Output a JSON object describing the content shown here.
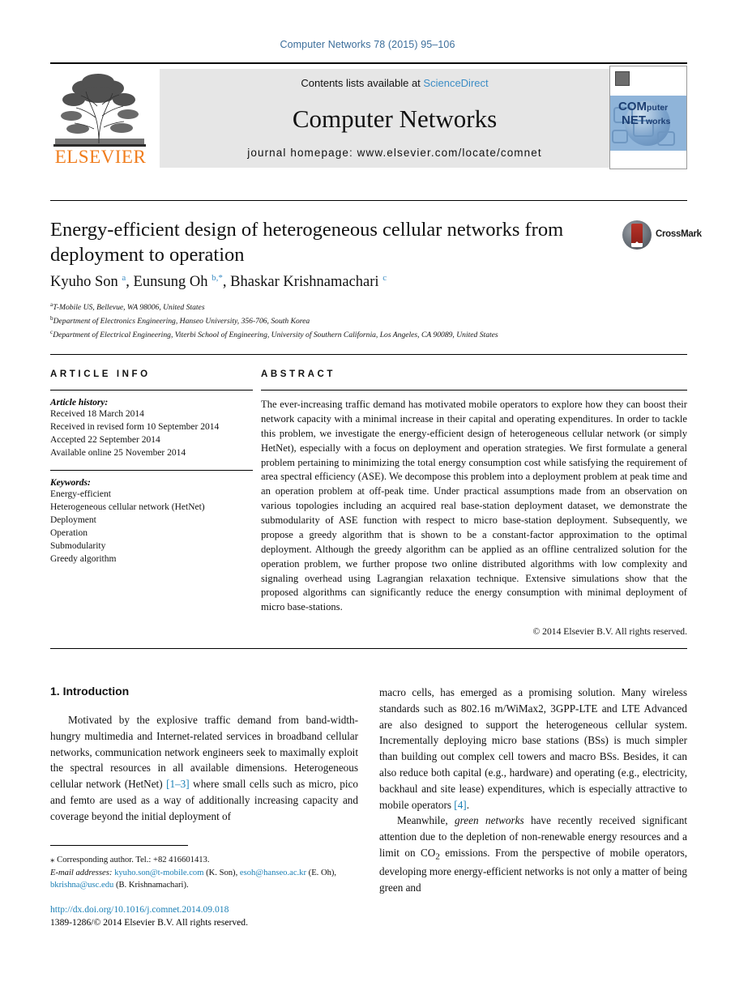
{
  "running_head": "Computer Networks 78 (2015) 95–106",
  "masthead": {
    "contents_prefix": "Contents lists available at",
    "contents_link": "ScienceDirect",
    "journal_title": "Computer Networks",
    "homepage": "journal homepage: www.elsevier.com/locate/comnet",
    "publisher_wordmark": "ELSEVIER",
    "cover_word_1": "COM",
    "cover_word_1_sub": "puter",
    "cover_word_2": "NET",
    "cover_word_2_sub": "works"
  },
  "article": {
    "title": "Energy-efficient design of heterogeneous cellular networks from deployment to operation",
    "crossmark_label": "CrossMark",
    "authors_html": "Kyuho Son <sup>a</sup>, Eunsung Oh <sup>b,*</sup>, Bhaskar Krishnamachari <sup>c</sup>",
    "affiliations": [
      "T-Mobile US, Bellevue, WA 98006, United States",
      "Department of Electronics Engineering, Hanseo University, 356-706, South Korea",
      "Department of Electrical Engineering, Viterbi School of Engineering, University of Southern California, Los Angeles, CA 90089, United States"
    ],
    "affiliation_marks": [
      "a",
      "b",
      "c"
    ]
  },
  "info": {
    "heading": "ARTICLE INFO",
    "history_title": "Article history:",
    "history": [
      "Received 18 March 2014",
      "Received in revised form 10 September 2014",
      "Accepted 22 September 2014",
      "Available online 25 November 2014"
    ],
    "keywords_title": "Keywords:",
    "keywords": [
      "Energy-efficient",
      "Heterogeneous cellular network (HetNet)",
      "Deployment",
      "Operation",
      "Submodularity",
      "Greedy algorithm"
    ]
  },
  "abstract": {
    "heading": "ABSTRACT",
    "text": "The ever-increasing traffic demand has motivated mobile operators to explore how they can boost their network capacity with a minimal increase in their capital and operating expenditures. In order to tackle this problem, we investigate the energy-efficient design of heterogeneous cellular network (or simply HetNet), especially with a focus on deployment and operation strategies. We first formulate a general problem pertaining to minimizing the total energy consumption cost while satisfying the requirement of area spectral efficiency (ASE). We decompose this problem into a deployment problem at peak time and an operation problem at off-peak time. Under practical assumptions made from an observation on various topologies including an acquired real base-station deployment dataset, we demonstrate the submodularity of ASE function with respect to micro base-station deployment. Subsequently, we propose a greedy algorithm that is shown to be a constant-factor approximation to the optimal deployment. Although the greedy algorithm can be applied as an offline centralized solution for the operation problem, we further propose two online distributed algorithms with low complexity and signaling overhead using Lagrangian relaxation technique. Extensive simulations show that the proposed algorithms can significantly reduce the energy consumption with minimal deployment of micro base-stations.",
    "copyright": "© 2014 Elsevier B.V. All rights reserved."
  },
  "body": {
    "section_title": "1. Introduction",
    "left_paragraph_html": "Motivated by the explosive traffic demand from band-width-hungry multimedia and Internet-related services in broadband cellular networks, communication network engineers seek to maximally exploit the spectral resources in all available dimensions. Heterogeneous cellular network (HetNet) <span class=\"ref\">[1–3]</span> where small cells such as micro, pico and femto are used as a way of additionally increasing capacity and coverage beyond the initial deployment of",
    "right_paragraph_1_html": "macro cells, has emerged as a promising solution. Many wireless standards such as 802.16 m/WiMax2, 3GPP-LTE and LTE Advanced are also designed to support the heterogeneous cellular system. Incrementally deploying micro base stations (BSs) is much simpler than building out complex cell towers and macro BSs. Besides, it can also reduce both capital (e.g., hardware) and operating (e.g., electricity, backhaul and site lease) expenditures, which is especially attractive to mobile operators <span class=\"ref\">[4]</span>.",
    "right_paragraph_2_html": "Meanwhile, <em>green networks</em> have recently received significant attention due to the depletion of non-renewable energy resources and a limit on CO<sub>2</sub> emissions. From the perspective of mobile operators, developing more energy-efficient networks is not only a matter of being green and"
  },
  "footnotes": {
    "corresponding_html": "<span class=\"fn-star\">⁎</span> Corresponding author. Tel.: +82 416601413.",
    "email_html": "<em>E-mail addresses:</em> <span class=\"lnk\">kyuho.son@t-mobile.com</span> (K. Son), <span class=\"lnk\">esoh@hanseo.ac.kr</span> (E. Oh), <span class=\"lnk\">bkrishna@usc.edu</span> (B. Krishnamachari).",
    "doi": "http://dx.doi.org/10.1016/j.comnet.2014.09.018",
    "issn_line": "1389-1286/© 2014 Elsevier B.V. All rights reserved."
  },
  "colors": {
    "link_blue": "#1a7fb5",
    "running_head_blue": "#3c6e9b",
    "elsevier_orange": "#f07c1b",
    "masthead_gray": "#e6e6e6",
    "cover_blue": "#8fb4d9"
  }
}
